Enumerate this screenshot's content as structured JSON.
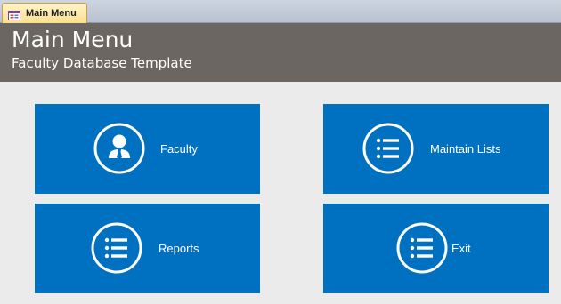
{
  "tab": {
    "label": "Main Menu",
    "icon": "form-icon"
  },
  "header": {
    "title": "Main Menu",
    "subtitle": "Faculty Database Template",
    "background_color": "#6b6661"
  },
  "tiles": [
    {
      "label": "Faculty",
      "icon": "person-icon"
    },
    {
      "label": "Maintain Lists",
      "icon": "list-icon"
    },
    {
      "label": "Reports",
      "icon": "list-icon"
    },
    {
      "label": "Exit",
      "icon": "list-icon"
    }
  ],
  "colors": {
    "tile": "#0070c0",
    "page_background": "#ebebeb"
  }
}
